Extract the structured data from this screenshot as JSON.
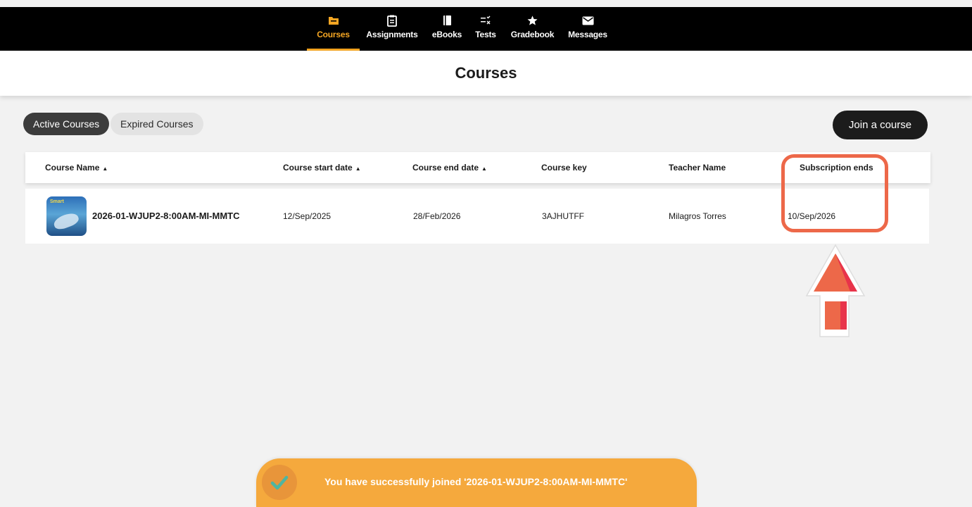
{
  "nav": {
    "items": [
      {
        "label": "Courses",
        "icon": "folder-icon",
        "active": true
      },
      {
        "label": "Assignments",
        "icon": "clipboard-icon",
        "active": false
      },
      {
        "label": "eBooks",
        "icon": "book-icon",
        "active": false
      },
      {
        "label": "Tests",
        "icon": "checklist-icon",
        "active": false
      },
      {
        "label": "Gradebook",
        "icon": "star-icon",
        "active": false
      },
      {
        "label": "Messages",
        "icon": "envelope-icon",
        "active": false
      }
    ]
  },
  "page": {
    "title": "Courses"
  },
  "tabs": {
    "active": "Active Courses",
    "expired": "Expired Courses"
  },
  "join_button": "Join a course",
  "table": {
    "headers": [
      "Course Name",
      "Course start date",
      "Course end date",
      "Course key",
      "Teacher Name",
      "Subscription ends"
    ],
    "sortable": [
      true,
      true,
      true,
      false,
      false,
      false
    ],
    "rows": [
      {
        "course_name": "2026-01-WJUP2-8:00AM-MI-MMTC",
        "start_date": "12/Sep/2025",
        "end_date": "28/Feb/2026",
        "course_key": "3AJHUTFF",
        "teacher": "Milagros Torres",
        "subscription_ends": "10/Sep/2026",
        "thumbnail_text": "Smart"
      }
    ]
  },
  "toast": {
    "message": "You have successfully joined '2026-01-WJUP2-8:00AM-MI-MMTC'"
  },
  "colors": {
    "accent": "#f5a623",
    "highlight": "#ed6849",
    "toast": "#f5a93d",
    "nav_bg": "#000000"
  }
}
